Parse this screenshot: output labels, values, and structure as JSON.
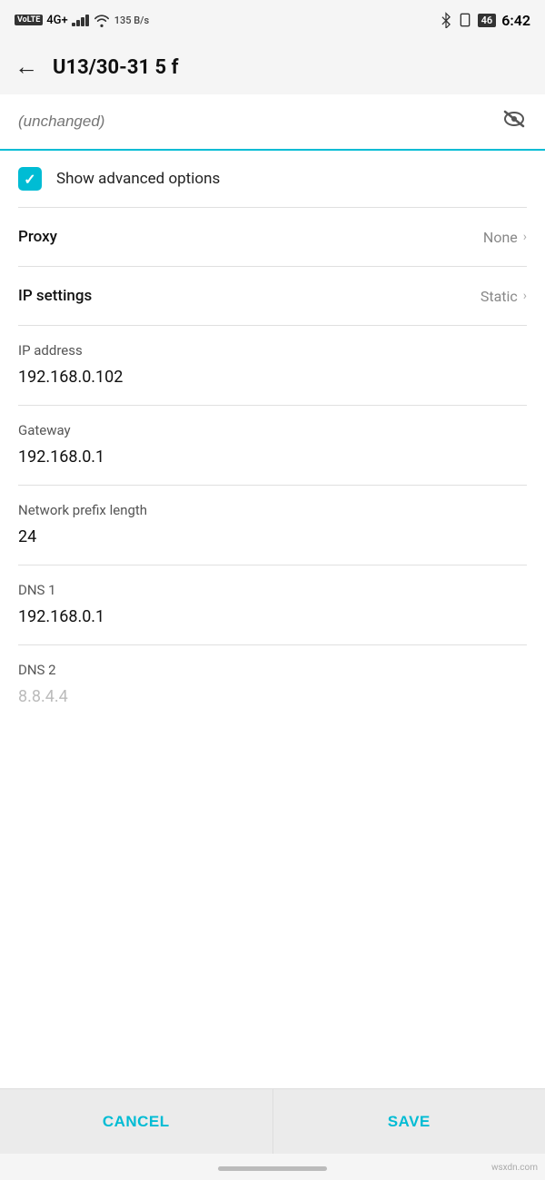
{
  "statusBar": {
    "left": {
      "volte": "VoLTE",
      "network": "4G+",
      "speed": "135 B/s"
    },
    "right": {
      "time": "6:42",
      "battery": "46"
    }
  },
  "header": {
    "backLabel": "←",
    "title": "U13/30-31 5 f"
  },
  "password": {
    "placeholder": "(unchanged)",
    "eyeIconLabel": "hide-password-icon"
  },
  "advancedOptions": {
    "label": "Show advanced options",
    "checked": true
  },
  "proxy": {
    "label": "Proxy",
    "value": "None"
  },
  "ipSettings": {
    "label": "IP settings",
    "value": "Static"
  },
  "ipAddress": {
    "label": "IP address",
    "value": "192.168.0.102"
  },
  "gateway": {
    "label": "Gateway",
    "value": "192.168.0.1"
  },
  "networkPrefixLength": {
    "label": "Network prefix length",
    "value": "24"
  },
  "dns1": {
    "label": "DNS 1",
    "value": "192.168.0.1"
  },
  "dns2": {
    "label": "DNS 2",
    "value": "8.8.4.4"
  },
  "buttons": {
    "cancel": "CANCEL",
    "save": "SAVE"
  },
  "watermark": "wsxdn.com"
}
